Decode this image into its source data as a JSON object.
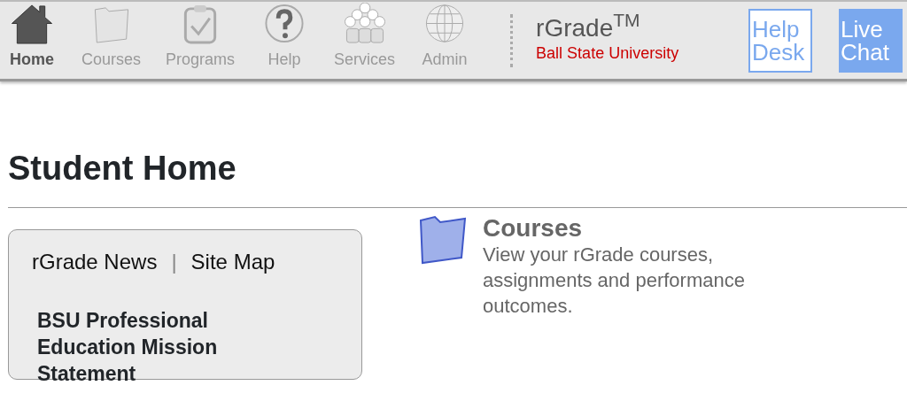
{
  "toolbar": {
    "items": [
      {
        "label": "Home",
        "kind": "house",
        "selected": true
      },
      {
        "label": "Courses",
        "kind": "folder",
        "selected": false
      },
      {
        "label": "Programs",
        "kind": "clipboard",
        "selected": false
      },
      {
        "label": "Help",
        "kind": "question",
        "selected": false
      },
      {
        "label": "Services",
        "kind": "people",
        "selected": false
      },
      {
        "label": "Admin",
        "kind": "globe",
        "selected": false
      }
    ],
    "brand": {
      "title": "rGrade$^{TM}$",
      "subtitle": "Ball State University"
    },
    "buttons": [
      {
        "label": "Help Desk",
        "kind": "outline"
      },
      {
        "label": "Live Chat",
        "kind": "filled"
      }
    ]
  },
  "page_title": "Student Home",
  "panel": {
    "links": [
      "rGrade News",
      "Site Map"
    ],
    "separator": "|",
    "heading": "BSU Professional Education Mission Statement"
  },
  "sections": [
    {
      "title": "Courses",
      "description": "View your rGrade courses, assignments and performance outcomes."
    }
  ]
}
